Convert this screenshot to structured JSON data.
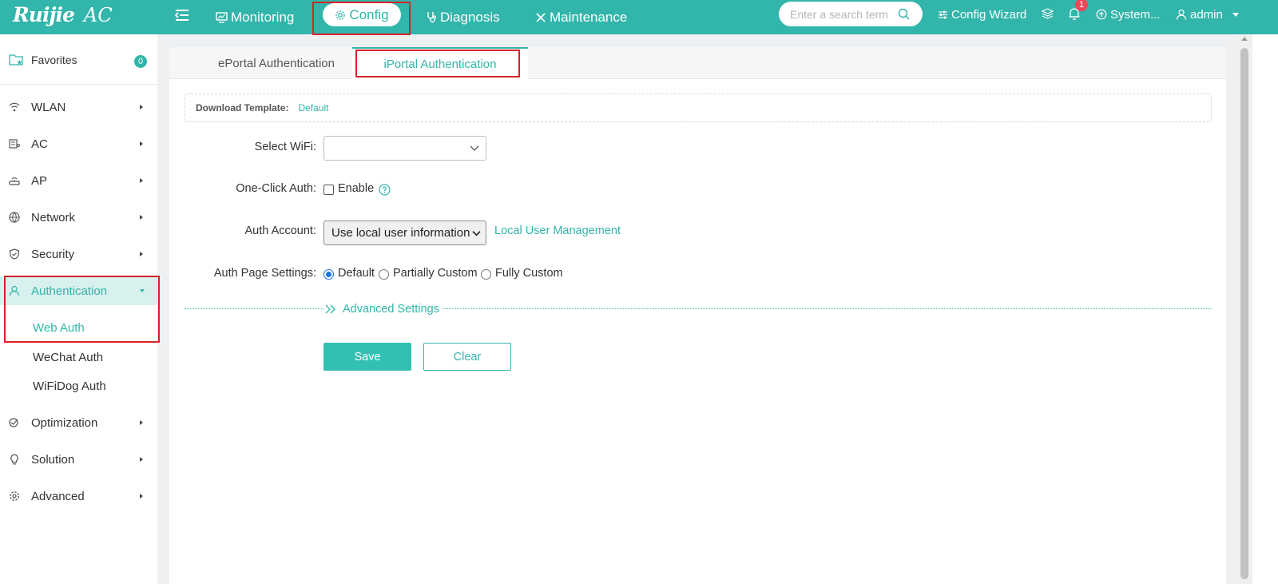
{
  "app": {
    "brand": "Ruijie",
    "product": "AC"
  },
  "topnav": {
    "items": [
      {
        "label": "Monitoring",
        "icon": "monitor-icon"
      },
      {
        "label": "Config",
        "icon": "gear-icon",
        "active": true
      },
      {
        "label": "Diagnosis",
        "icon": "stethoscope-icon"
      },
      {
        "label": "Maintenance",
        "icon": "tools-icon"
      }
    ],
    "search_placeholder": "Enter a search term",
    "config_wizard": "Config Wizard",
    "notification_count": "1",
    "system": "System...",
    "user": "admin"
  },
  "sidebar": {
    "favorites": {
      "label": "Favorites",
      "count": "0"
    },
    "items": [
      {
        "label": "WLAN",
        "icon": "wlan-icon"
      },
      {
        "label": "AC",
        "icon": "ac-icon"
      },
      {
        "label": "AP",
        "icon": "ap-icon"
      },
      {
        "label": "Network",
        "icon": "network-icon"
      },
      {
        "label": "Security",
        "icon": "shield-icon"
      },
      {
        "label": "Authentication",
        "icon": "user-icon",
        "expanded": true
      },
      {
        "label": "Optimization",
        "icon": "optimization-icon"
      },
      {
        "label": "Solution",
        "icon": "bulb-icon"
      },
      {
        "label": "Advanced",
        "icon": "gear-icon"
      }
    ],
    "auth_subitems": [
      {
        "label": "Web Auth",
        "active": true
      },
      {
        "label": "WeChat Auth"
      },
      {
        "label": "WiFiDog Auth"
      }
    ]
  },
  "tabs": [
    {
      "label": "ePortal Authentication"
    },
    {
      "label": "iPortal Authentication",
      "active": true
    }
  ],
  "download": {
    "label": "Download Template:",
    "link": "Default"
  },
  "form": {
    "select_wifi": {
      "label": "Select WiFi:",
      "value": ""
    },
    "one_click": {
      "label": "One-Click Auth:",
      "option": "Enable",
      "checked": false
    },
    "auth_account": {
      "label": "Auth Account:",
      "value": "Use local user information",
      "link": "Local User Management"
    },
    "auth_page": {
      "label": "Auth Page Settings:",
      "options": [
        "Default",
        "Partially Custom",
        "Fully Custom"
      ],
      "selected": "Default"
    },
    "advanced": "Advanced Settings",
    "save": "Save",
    "clear": "Clear"
  },
  "colors": {
    "accent": "#32b5aa",
    "highlight": "#d9232a",
    "badge": "#f0465a"
  }
}
